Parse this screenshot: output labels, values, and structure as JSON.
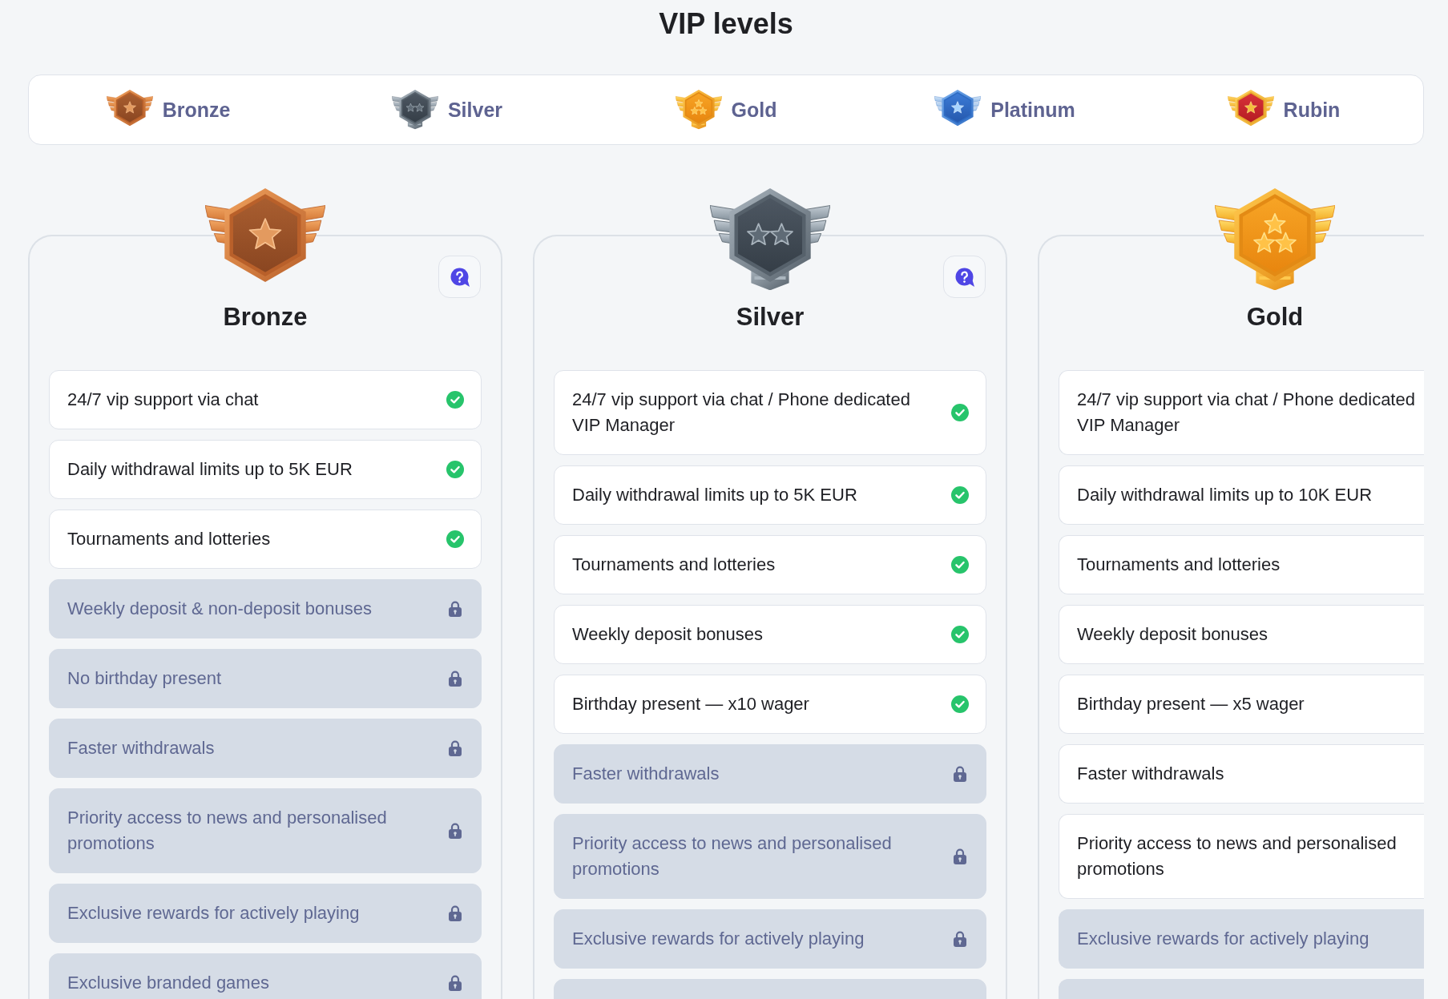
{
  "title": "VIP levels",
  "tabs": [
    {
      "label": "Bronze",
      "kind": "bronze"
    },
    {
      "label": "Silver",
      "kind": "silver"
    },
    {
      "label": "Gold",
      "kind": "gold"
    },
    {
      "label": "Platinum",
      "kind": "platinum"
    },
    {
      "label": "Rubin",
      "kind": "rubin"
    }
  ],
  "cards": [
    {
      "title": "Bronze",
      "kind": "bronze",
      "cut_off": false,
      "rows": [
        {
          "text": "24/7 vip support via chat",
          "locked": false
        },
        {
          "text": "Daily withdrawal limits up to 5K EUR",
          "locked": false
        },
        {
          "text": "Tournaments and lotteries",
          "locked": false
        },
        {
          "text": "Weekly deposit & non-deposit bonuses",
          "locked": true
        },
        {
          "text": "No birthday present",
          "locked": true
        },
        {
          "text": "Faster withdrawals",
          "locked": true
        },
        {
          "text": "Priority access to news and personalised promotions",
          "locked": true
        },
        {
          "text": "Exclusive rewards for actively playing",
          "locked": true
        },
        {
          "text": "Exclusive branded games",
          "locked": true
        }
      ]
    },
    {
      "title": "Silver",
      "kind": "silver",
      "cut_off": false,
      "rows": [
        {
          "text": "24/7 vip support via chat / Phone dedicated VIP Manager",
          "locked": false
        },
        {
          "text": "Daily withdrawal limits up to 5K EUR",
          "locked": false
        },
        {
          "text": "Tournaments and lotteries",
          "locked": false
        },
        {
          "text": "Weekly deposit bonuses",
          "locked": false
        },
        {
          "text": "Birthday present — x10 wager",
          "locked": false
        },
        {
          "text": "Faster withdrawals",
          "locked": true
        },
        {
          "text": "Priority access to news and personalised promotions",
          "locked": true
        },
        {
          "text": "Exclusive rewards for actively playing",
          "locked": true
        },
        {
          "locked": true
        }
      ]
    },
    {
      "title": "Gold",
      "kind": "gold",
      "cut_off": true,
      "rows": [
        {
          "text": "24/7 vip support via chat / Phone dedicated VIP Manager",
          "locked": false
        },
        {
          "text": "Daily withdrawal limits up to 10K EUR",
          "locked": false
        },
        {
          "text": "Tournaments and lotteries",
          "locked": false
        },
        {
          "text": "Weekly deposit bonuses",
          "locked": false
        },
        {
          "text": "Birthday present — x5 wager",
          "locked": false
        },
        {
          "text": "Faster withdrawals",
          "locked": false
        },
        {
          "text": "Priority access to news and personalised promotions",
          "locked": false
        },
        {
          "text": "Exclusive rewards for actively playing",
          "locked": true
        },
        {
          "locked": true
        }
      ]
    }
  ]
}
